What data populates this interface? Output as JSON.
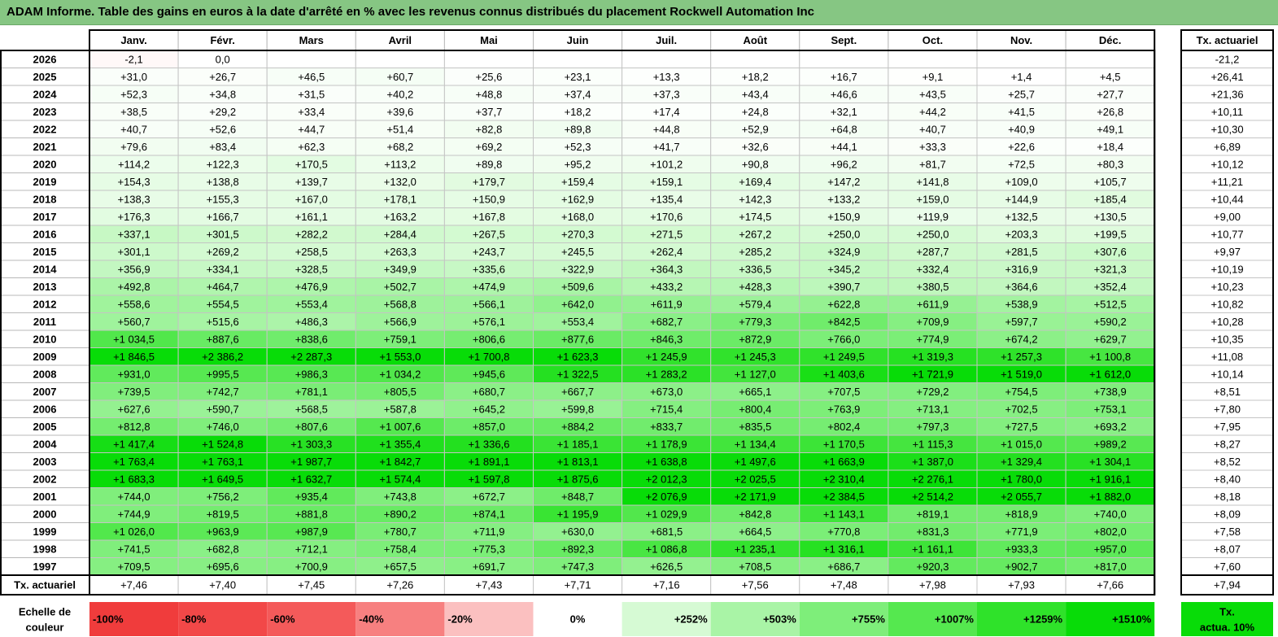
{
  "title": "ADAM Informe. Table des gains en euros à la date d'arrêté en % avec les revenus connus distribués du placement Rockwell Automation Inc",
  "chart_data": {
    "type": "table",
    "months": [
      "Janv.",
      "Févr.",
      "Mars",
      "Avril",
      "Mai",
      "Juin",
      "Juil.",
      "Août",
      "Sept.",
      "Oct.",
      "Nov.",
      "Déc."
    ],
    "rate_header": "Tx. actuariel",
    "rows": [
      {
        "year": "2026",
        "values": [
          "-2,1",
          "0,0",
          "",
          "",
          "",
          "",
          "",
          "",
          "",
          "",
          "",
          ""
        ],
        "rate": "-21,2"
      },
      {
        "year": "2025",
        "values": [
          "+31,0",
          "+26,7",
          "+46,5",
          "+60,7",
          "+25,6",
          "+23,1",
          "+13,3",
          "+18,2",
          "+16,7",
          "+9,1",
          "+1,4",
          "+4,5"
        ],
        "rate": "+26,41"
      },
      {
        "year": "2024",
        "values": [
          "+52,3",
          "+34,8",
          "+31,5",
          "+40,2",
          "+48,8",
          "+37,4",
          "+37,3",
          "+43,4",
          "+46,6",
          "+43,5",
          "+25,7",
          "+27,7"
        ],
        "rate": "+21,36"
      },
      {
        "year": "2023",
        "values": [
          "+38,5",
          "+29,2",
          "+33,4",
          "+39,6",
          "+37,7",
          "+18,2",
          "+17,4",
          "+24,8",
          "+32,1",
          "+44,2",
          "+41,5",
          "+26,8"
        ],
        "rate": "+10,11"
      },
      {
        "year": "2022",
        "values": [
          "+40,7",
          "+52,6",
          "+44,7",
          "+51,4",
          "+82,8",
          "+89,8",
          "+44,8",
          "+52,9",
          "+64,8",
          "+40,7",
          "+40,9",
          "+49,1"
        ],
        "rate": "+10,30"
      },
      {
        "year": "2021",
        "values": [
          "+79,6",
          "+83,4",
          "+62,3",
          "+68,2",
          "+69,2",
          "+52,3",
          "+41,7",
          "+32,6",
          "+44,1",
          "+33,3",
          "+22,6",
          "+18,4"
        ],
        "rate": "+6,89"
      },
      {
        "year": "2020",
        "values": [
          "+114,2",
          "+122,3",
          "+170,5",
          "+113,2",
          "+89,8",
          "+95,2",
          "+101,2",
          "+90,8",
          "+96,2",
          "+81,7",
          "+72,5",
          "+80,3"
        ],
        "rate": "+10,12"
      },
      {
        "year": "2019",
        "values": [
          "+154,3",
          "+138,8",
          "+139,7",
          "+132,0",
          "+179,7",
          "+159,4",
          "+159,1",
          "+169,4",
          "+147,2",
          "+141,8",
          "+109,0",
          "+105,7"
        ],
        "rate": "+11,21"
      },
      {
        "year": "2018",
        "values": [
          "+138,3",
          "+155,3",
          "+167,0",
          "+178,1",
          "+150,9",
          "+162,9",
          "+135,4",
          "+142,3",
          "+133,2",
          "+159,0",
          "+144,9",
          "+185,4"
        ],
        "rate": "+10,44"
      },
      {
        "year": "2017",
        "values": [
          "+176,3",
          "+166,7",
          "+161,1",
          "+163,2",
          "+167,8",
          "+168,0",
          "+170,6",
          "+174,5",
          "+150,9",
          "+119,9",
          "+132,5",
          "+130,5"
        ],
        "rate": "+9,00"
      },
      {
        "year": "2016",
        "values": [
          "+337,1",
          "+301,5",
          "+282,2",
          "+284,4",
          "+267,5",
          "+270,3",
          "+271,5",
          "+267,2",
          "+250,0",
          "+250,0",
          "+203,3",
          "+199,5"
        ],
        "rate": "+10,77"
      },
      {
        "year": "2015",
        "values": [
          "+301,1",
          "+269,2",
          "+258,5",
          "+263,3",
          "+243,7",
          "+245,5",
          "+262,4",
          "+285,2",
          "+324,9",
          "+287,7",
          "+281,5",
          "+307,6"
        ],
        "rate": "+9,97"
      },
      {
        "year": "2014",
        "values": [
          "+356,9",
          "+334,1",
          "+328,5",
          "+349,9",
          "+335,6",
          "+322,9",
          "+364,3",
          "+336,5",
          "+345,2",
          "+332,4",
          "+316,9",
          "+321,3"
        ],
        "rate": "+10,19"
      },
      {
        "year": "2013",
        "values": [
          "+492,8",
          "+464,7",
          "+476,9",
          "+502,7",
          "+474,9",
          "+509,6",
          "+433,2",
          "+428,3",
          "+390,7",
          "+380,5",
          "+364,6",
          "+352,4"
        ],
        "rate": "+10,23"
      },
      {
        "year": "2012",
        "values": [
          "+558,6",
          "+554,5",
          "+553,4",
          "+568,8",
          "+566,1",
          "+642,0",
          "+611,9",
          "+579,4",
          "+622,8",
          "+611,9",
          "+538,9",
          "+512,5"
        ],
        "rate": "+10,82"
      },
      {
        "year": "2011",
        "values": [
          "+560,7",
          "+515,6",
          "+486,3",
          "+566,9",
          "+576,1",
          "+553,4",
          "+682,7",
          "+779,3",
          "+842,5",
          "+709,9",
          "+597,7",
          "+590,2"
        ],
        "rate": "+10,28"
      },
      {
        "year": "2010",
        "values": [
          "+1 034,5",
          "+887,6",
          "+838,6",
          "+759,1",
          "+806,6",
          "+877,6",
          "+846,3",
          "+872,9",
          "+766,0",
          "+774,9",
          "+674,2",
          "+629,7"
        ],
        "rate": "+10,35"
      },
      {
        "year": "2009",
        "values": [
          "+1 846,5",
          "+2 386,2",
          "+2 287,3",
          "+1 553,0",
          "+1 700,8",
          "+1 623,3",
          "+1 245,9",
          "+1 245,3",
          "+1 249,5",
          "+1 319,3",
          "+1 257,3",
          "+1 100,8"
        ],
        "rate": "+11,08"
      },
      {
        "year": "2008",
        "values": [
          "+931,0",
          "+995,5",
          "+986,3",
          "+1 034,2",
          "+945,6",
          "+1 322,5",
          "+1 283,2",
          "+1 127,0",
          "+1 403,6",
          "+1 721,9",
          "+1 519,0",
          "+1 612,0"
        ],
        "rate": "+10,14"
      },
      {
        "year": "2007",
        "values": [
          "+739,5",
          "+742,7",
          "+781,1",
          "+805,5",
          "+680,7",
          "+667,7",
          "+673,0",
          "+665,1",
          "+707,5",
          "+729,2",
          "+754,5",
          "+738,9"
        ],
        "rate": "+8,51"
      },
      {
        "year": "2006",
        "values": [
          "+627,6",
          "+590,7",
          "+568,5",
          "+587,8",
          "+645,2",
          "+599,8",
          "+715,4",
          "+800,4",
          "+763,9",
          "+713,1",
          "+702,5",
          "+753,1"
        ],
        "rate": "+7,80"
      },
      {
        "year": "2005",
        "values": [
          "+812,8",
          "+746,0",
          "+807,6",
          "+1 007,6",
          "+857,0",
          "+884,2",
          "+833,7",
          "+835,5",
          "+802,4",
          "+797,3",
          "+727,5",
          "+693,2"
        ],
        "rate": "+7,95"
      },
      {
        "year": "2004",
        "values": [
          "+1 417,4",
          "+1 524,8",
          "+1 303,3",
          "+1 355,4",
          "+1 336,6",
          "+1 185,1",
          "+1 178,9",
          "+1 134,4",
          "+1 170,5",
          "+1 115,3",
          "+1 015,0",
          "+989,2"
        ],
        "rate": "+8,27"
      },
      {
        "year": "2003",
        "values": [
          "+1 763,4",
          "+1 763,1",
          "+1 987,7",
          "+1 842,7",
          "+1 891,1",
          "+1 813,1",
          "+1 638,8",
          "+1 497,6",
          "+1 663,9",
          "+1 387,0",
          "+1 329,4",
          "+1 304,1"
        ],
        "rate": "+8,52"
      },
      {
        "year": "2002",
        "values": [
          "+1 683,3",
          "+1 649,5",
          "+1 632,7",
          "+1 574,4",
          "+1 597,8",
          "+1 875,6",
          "+2 012,3",
          "+2 025,5",
          "+2 310,4",
          "+2 276,1",
          "+1 780,0",
          "+1 916,1"
        ],
        "rate": "+8,40"
      },
      {
        "year": "2001",
        "values": [
          "+744,0",
          "+756,2",
          "+935,4",
          "+743,8",
          "+672,7",
          "+848,7",
          "+2 076,9",
          "+2 171,9",
          "+2 384,5",
          "+2 514,2",
          "+2 055,7",
          "+1 882,0"
        ],
        "rate": "+8,18"
      },
      {
        "year": "2000",
        "values": [
          "+744,9",
          "+819,5",
          "+881,8",
          "+890,2",
          "+874,1",
          "+1 195,9",
          "+1 029,9",
          "+842,8",
          "+1 143,1",
          "+819,1",
          "+818,9",
          "+740,0"
        ],
        "rate": "+8,09"
      },
      {
        "year": "1999",
        "values": [
          "+1 026,0",
          "+963,9",
          "+987,9",
          "+780,7",
          "+711,9",
          "+630,0",
          "+681,5",
          "+664,5",
          "+770,8",
          "+831,3",
          "+771,9",
          "+802,0"
        ],
        "rate": "+7,58"
      },
      {
        "year": "1998",
        "values": [
          "+741,5",
          "+682,8",
          "+712,1",
          "+758,4",
          "+775,3",
          "+892,3",
          "+1 086,8",
          "+1 235,1",
          "+1 316,1",
          "+1 161,1",
          "+933,3",
          "+957,0"
        ],
        "rate": "+8,07"
      },
      {
        "year": "1997",
        "values": [
          "+709,5",
          "+695,6",
          "+700,9",
          "+657,5",
          "+691,7",
          "+747,3",
          "+626,5",
          "+708,5",
          "+686,7",
          "+920,3",
          "+902,7",
          "+817,0"
        ],
        "rate": "+7,60"
      }
    ],
    "footer": {
      "label": "Tx. actuariel",
      "values": [
        "+7,46",
        "+7,40",
        "+7,45",
        "+7,26",
        "+7,43",
        "+7,71",
        "+7,16",
        "+7,56",
        "+7,48",
        "+7,98",
        "+7,93",
        "+7,66"
      ],
      "rate": "+7,94"
    },
    "color_scale": {
      "label_line1": "Echelle de",
      "label_line2": "couleur",
      "steps": [
        {
          "label": "-100%",
          "value": -100,
          "color": "#f03c3c"
        },
        {
          "label": "-80%",
          "value": -80,
          "color": "#f24848"
        },
        {
          "label": "-60%",
          "value": -60,
          "color": "#f45a5a"
        },
        {
          "label": "-40%",
          "value": -40,
          "color": "#f78080"
        },
        {
          "label": "-20%",
          "value": -20,
          "color": "#fbc0c0"
        },
        {
          "label": "0%",
          "value": 0,
          "color": "#ffffff"
        },
        {
          "label": "+252%",
          "value": 252,
          "color": "#d6fad4"
        },
        {
          "label": "+503%",
          "value": 503,
          "color": "#a9f4a6"
        },
        {
          "label": "+755%",
          "value": 755,
          "color": "#7eee7a"
        },
        {
          "label": "+1007%",
          "value": 1007,
          "color": "#55e84f"
        },
        {
          "label": "+1259%",
          "value": 1259,
          "color": "#2fe22a"
        },
        {
          "label": "+1510%",
          "value": 1510,
          "color": "#08dc08"
        }
      ],
      "rate_label_line1": "Tx.",
      "rate_label_line2": "actua. 10%",
      "rate_color": "#08dc08"
    }
  }
}
